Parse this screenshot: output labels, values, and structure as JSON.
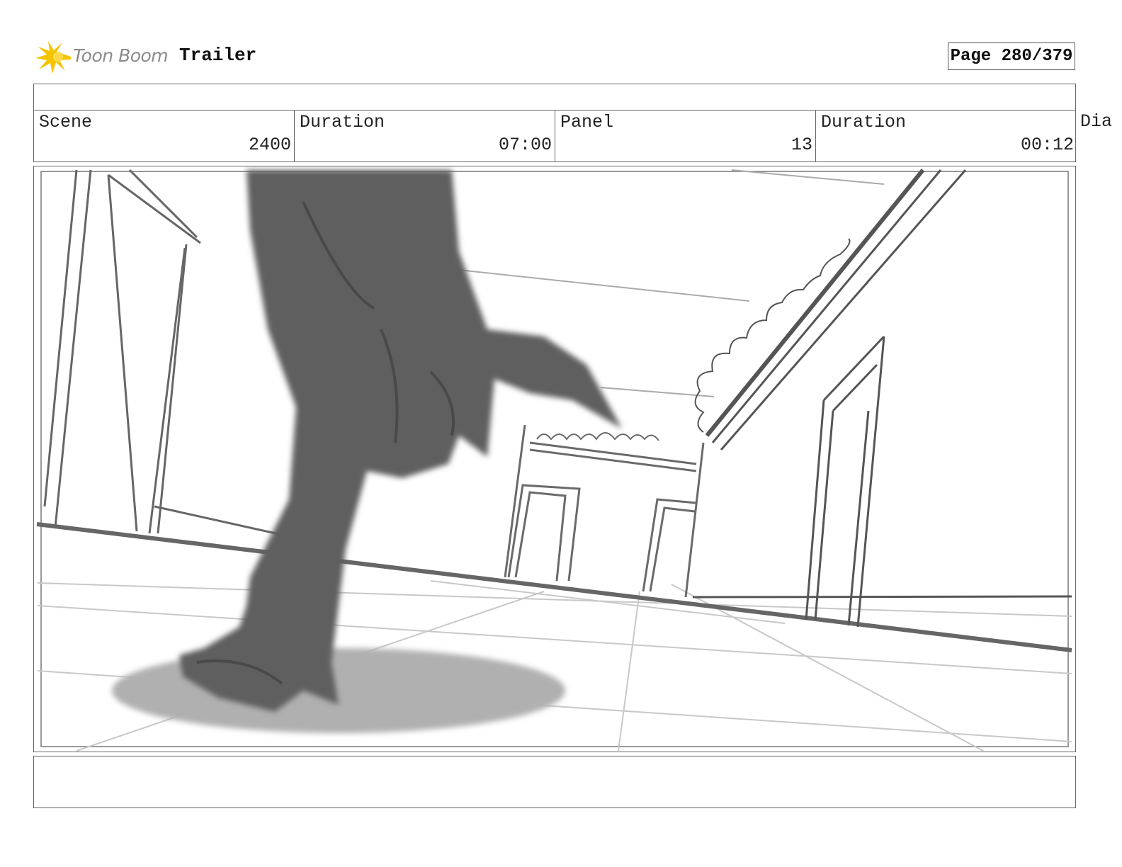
{
  "header": {
    "brand": "Toon Boom",
    "project_title": "Trailer",
    "page_label": "Page 280/379"
  },
  "info": [
    {
      "label": "Scene",
      "value": "2400"
    },
    {
      "label": "Duration",
      "value": "07:00"
    },
    {
      "label": "Panel",
      "value": "13"
    },
    {
      "label": "Duration",
      "value": "00:12"
    }
  ],
  "overflow_label": "Dia",
  "caption_text": "",
  "colors": {
    "logo_star": "#f5c400",
    "sketch_dark": "#5f5f5f",
    "shadow": "#b0b0b0",
    "line": "#555555"
  }
}
